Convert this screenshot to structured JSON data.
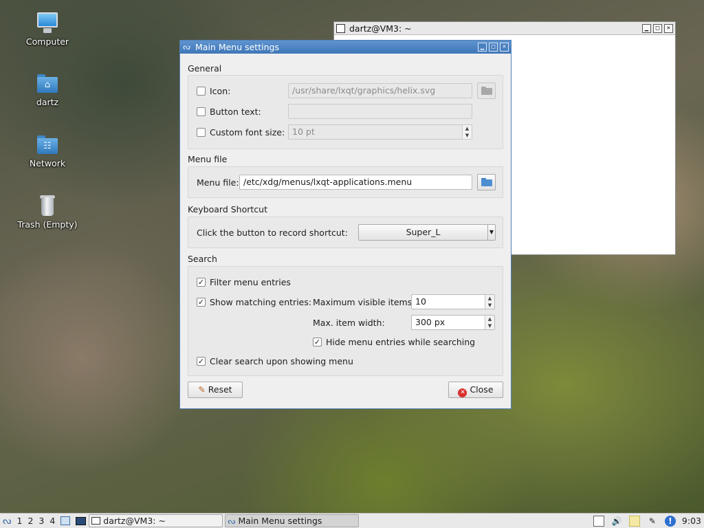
{
  "desktop": {
    "icons": [
      {
        "label": "Computer",
        "icon": "computer-icon"
      },
      {
        "label": "dartz",
        "icon": "home-folder-icon"
      },
      {
        "label": "Network",
        "icon": "network-folder-icon"
      },
      {
        "label": "Trash (Empty)",
        "icon": "trash-icon"
      }
    ]
  },
  "terminal": {
    "title": "dartz@VM3: ~"
  },
  "dialog": {
    "title": "Main Menu settings",
    "general": {
      "title": "General",
      "icon_label": "Icon:",
      "icon_value": "/usr/share/lxqt/graphics/helix.svg",
      "icon_checked": false,
      "button_text_label": "Button text:",
      "button_text_value": "",
      "button_text_checked": false,
      "font_size_label": "Custom font size:",
      "font_size_value": "10 pt",
      "font_size_checked": false
    },
    "menu_file": {
      "title": "Menu file",
      "label": "Menu file:",
      "value": "/etc/xdg/menus/lxqt-applications.menu"
    },
    "shortcut": {
      "title": "Keyboard Shortcut",
      "label": "Click the button to record shortcut:",
      "value": "Super_L"
    },
    "search": {
      "title": "Search",
      "filter_label": "Filter menu entries",
      "filter_checked": true,
      "show_matching_label": "Show matching entries:",
      "show_matching_checked": true,
      "max_visible_label": "Maximum visible items:",
      "max_visible_value": "10",
      "max_width_label": "Max. item width:",
      "max_width_value": "300 px",
      "hide_entries_label": "Hide menu entries while searching",
      "hide_entries_checked": true,
      "clear_search_label": "Clear search upon showing menu",
      "clear_search_checked": true
    },
    "buttons": {
      "reset": "Reset",
      "close": "Close"
    }
  },
  "taskbar": {
    "workspaces": [
      "1",
      "2",
      "3",
      "4"
    ],
    "tasks": [
      {
        "label": "dartz@VM3: ~",
        "active": false
      },
      {
        "label": "Main Menu settings",
        "active": true
      }
    ],
    "clock": "9:03"
  },
  "colors": {
    "titlebar_active": "#3f76b8",
    "close_icon": "#d9302c"
  }
}
